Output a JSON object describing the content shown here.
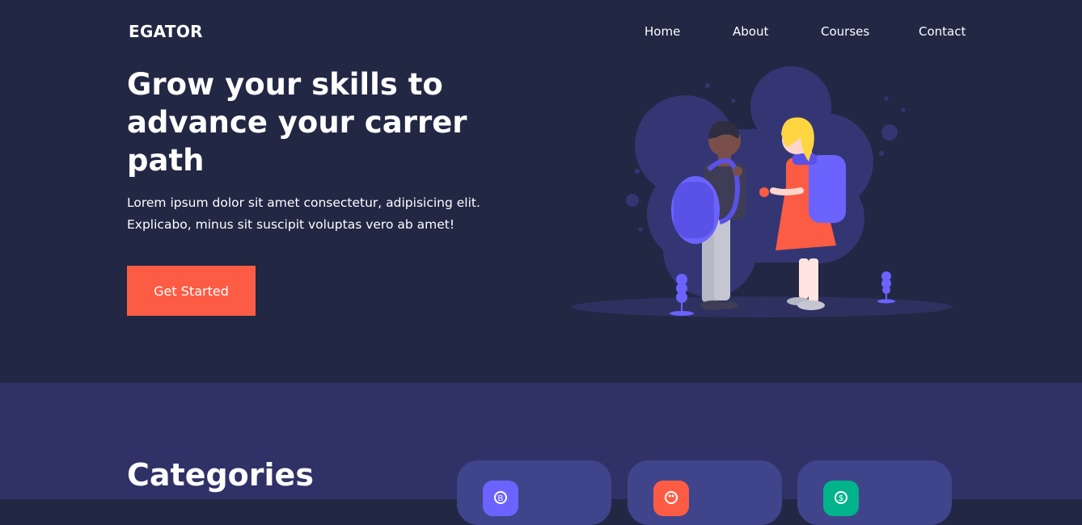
{
  "header": {
    "logo": "EGATOR",
    "nav": [
      {
        "label": "Home"
      },
      {
        "label": "About"
      },
      {
        "label": "Courses"
      },
      {
        "label": "Contact"
      }
    ]
  },
  "hero": {
    "title": "Grow your skills to advance your carrer path",
    "description": "Lorem ipsum dolor sit amet consectetur, adipisicing elit. Explicabo, minus sit suscipit voluptas vero ab amet!",
    "cta_label": "Get Started"
  },
  "categories": {
    "title": "Categories",
    "cards": [
      {
        "icon": "bitcoin-icon",
        "icon_color": "#6c63ff"
      },
      {
        "icon": "palette-icon",
        "icon_color": "#fc5c44"
      },
      {
        "icon": "dollar-icon",
        "icon_color": "#00b38b"
      }
    ]
  },
  "colors": {
    "hero_bg": "#222744",
    "section_bg": "#303166",
    "card_bg": "#40448a",
    "accent": "#fc5c44",
    "purple": "#6c63ff"
  }
}
